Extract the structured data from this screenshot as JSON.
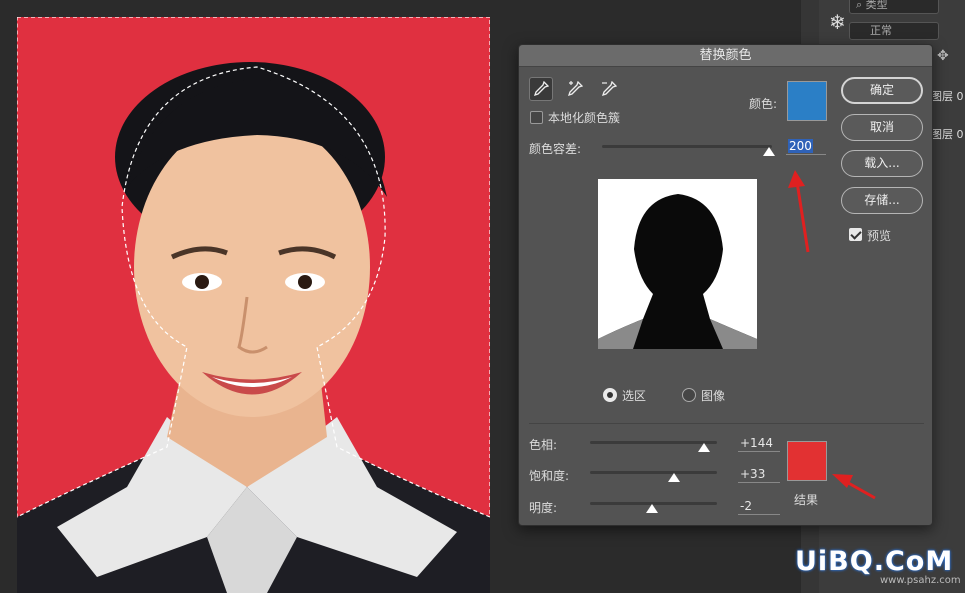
{
  "dialog": {
    "title": "替换颜色",
    "localized_clusters_label": "本地化颜色簇",
    "color_label": "颜色:",
    "fuzziness_label": "颜色容差:",
    "fuzziness_value": "200",
    "fuzziness_fraction": 1.0,
    "selection_label": "选区",
    "image_label": "图像",
    "selected_view": "选区",
    "hue_label": "色相:",
    "hue_value": "+144",
    "hue_fraction": 0.9,
    "saturation_label": "饱和度:",
    "saturation_value": "+33",
    "saturation_fraction": 0.66,
    "lightness_label": "明度:",
    "lightness_value": "-2",
    "lightness_fraction": 0.49,
    "result_label": "结果",
    "ok_label": "确定",
    "cancel_label": "取消",
    "load_label": "载入...",
    "save_label": "存储...",
    "preview_label": "预览",
    "preview_checked": true,
    "localized_checked": false,
    "sample_color": "#2b7fc6",
    "result_color": "#e23132"
  },
  "layers_panel": {
    "filter_placeholder": "类型",
    "blend_mode": "正常",
    "layer_1": "图层 0",
    "layer_2": "图层 0"
  },
  "photo": {
    "background_color": "#e03040"
  },
  "watermark": {
    "text": "UiBQ.CoM",
    "sub": "www.psahz.com"
  }
}
